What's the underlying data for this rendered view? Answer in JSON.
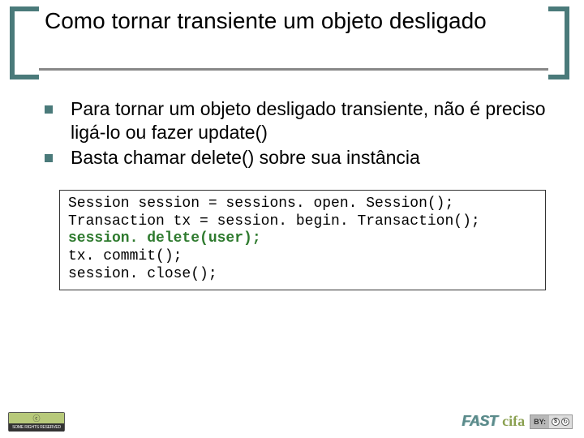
{
  "title": "Como tornar transiente um objeto desligado",
  "bullets": [
    "Para tornar um objeto desligado transiente, não é preciso ligá-lo ou fazer update()",
    "Basta chamar delete() sobre sua instância"
  ],
  "code": {
    "line1": "Session session = sessions. open. Session();",
    "line2": "Transaction tx = session. begin. Transaction();",
    "line3": "session. delete(user);",
    "line4": "tx. commit();",
    "line5": "session. close();"
  },
  "footer": {
    "cc_top": "ⓒ ",
    "cc_bot": "SOME RIGHTS RESERVED",
    "fast": "FAST",
    "cifa": "cifa",
    "by": "BY:",
    "sym1": "$",
    "sym2": "↻"
  }
}
